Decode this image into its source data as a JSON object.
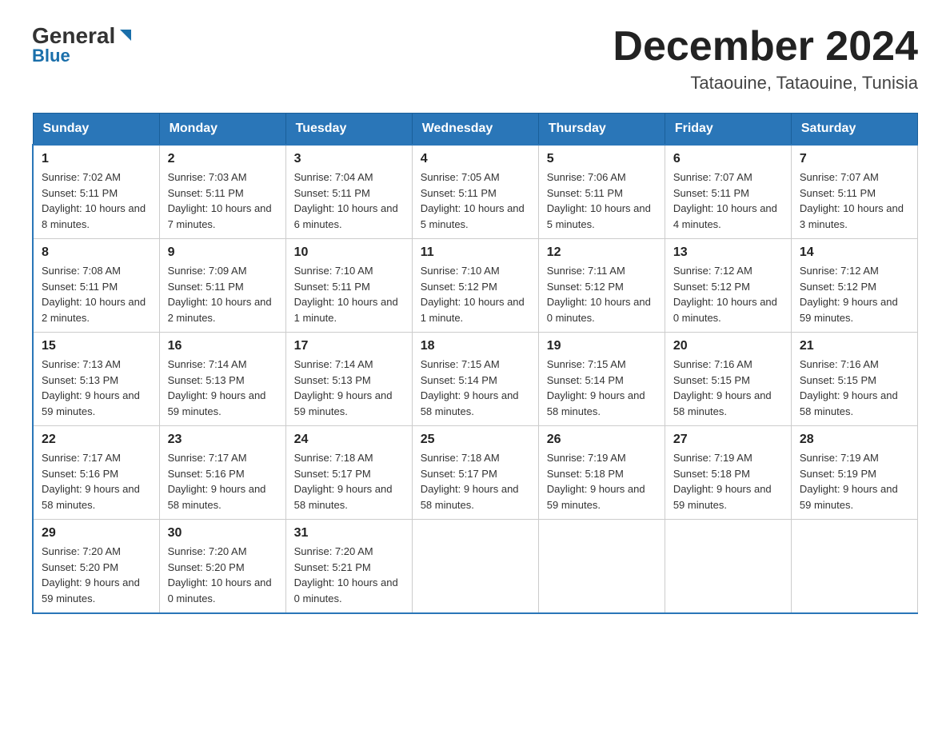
{
  "logo": {
    "general": "General",
    "blue": "Blue"
  },
  "title": "December 2024",
  "subtitle": "Tataouine, Tataouine, Tunisia",
  "days": [
    "Sunday",
    "Monday",
    "Tuesday",
    "Wednesday",
    "Thursday",
    "Friday",
    "Saturday"
  ],
  "weeks": [
    [
      {
        "day": "1",
        "sunrise": "7:02 AM",
        "sunset": "5:11 PM",
        "daylight": "10 hours and 8 minutes."
      },
      {
        "day": "2",
        "sunrise": "7:03 AM",
        "sunset": "5:11 PM",
        "daylight": "10 hours and 7 minutes."
      },
      {
        "day": "3",
        "sunrise": "7:04 AM",
        "sunset": "5:11 PM",
        "daylight": "10 hours and 6 minutes."
      },
      {
        "day": "4",
        "sunrise": "7:05 AM",
        "sunset": "5:11 PM",
        "daylight": "10 hours and 5 minutes."
      },
      {
        "day": "5",
        "sunrise": "7:06 AM",
        "sunset": "5:11 PM",
        "daylight": "10 hours and 5 minutes."
      },
      {
        "day": "6",
        "sunrise": "7:07 AM",
        "sunset": "5:11 PM",
        "daylight": "10 hours and 4 minutes."
      },
      {
        "day": "7",
        "sunrise": "7:07 AM",
        "sunset": "5:11 PM",
        "daylight": "10 hours and 3 minutes."
      }
    ],
    [
      {
        "day": "8",
        "sunrise": "7:08 AM",
        "sunset": "5:11 PM",
        "daylight": "10 hours and 2 minutes."
      },
      {
        "day": "9",
        "sunrise": "7:09 AM",
        "sunset": "5:11 PM",
        "daylight": "10 hours and 2 minutes."
      },
      {
        "day": "10",
        "sunrise": "7:10 AM",
        "sunset": "5:11 PM",
        "daylight": "10 hours and 1 minute."
      },
      {
        "day": "11",
        "sunrise": "7:10 AM",
        "sunset": "5:12 PM",
        "daylight": "10 hours and 1 minute."
      },
      {
        "day": "12",
        "sunrise": "7:11 AM",
        "sunset": "5:12 PM",
        "daylight": "10 hours and 0 minutes."
      },
      {
        "day": "13",
        "sunrise": "7:12 AM",
        "sunset": "5:12 PM",
        "daylight": "10 hours and 0 minutes."
      },
      {
        "day": "14",
        "sunrise": "7:12 AM",
        "sunset": "5:12 PM",
        "daylight": "9 hours and 59 minutes."
      }
    ],
    [
      {
        "day": "15",
        "sunrise": "7:13 AM",
        "sunset": "5:13 PM",
        "daylight": "9 hours and 59 minutes."
      },
      {
        "day": "16",
        "sunrise": "7:14 AM",
        "sunset": "5:13 PM",
        "daylight": "9 hours and 59 minutes."
      },
      {
        "day": "17",
        "sunrise": "7:14 AM",
        "sunset": "5:13 PM",
        "daylight": "9 hours and 59 minutes."
      },
      {
        "day": "18",
        "sunrise": "7:15 AM",
        "sunset": "5:14 PM",
        "daylight": "9 hours and 58 minutes."
      },
      {
        "day": "19",
        "sunrise": "7:15 AM",
        "sunset": "5:14 PM",
        "daylight": "9 hours and 58 minutes."
      },
      {
        "day": "20",
        "sunrise": "7:16 AM",
        "sunset": "5:15 PM",
        "daylight": "9 hours and 58 minutes."
      },
      {
        "day": "21",
        "sunrise": "7:16 AM",
        "sunset": "5:15 PM",
        "daylight": "9 hours and 58 minutes."
      }
    ],
    [
      {
        "day": "22",
        "sunrise": "7:17 AM",
        "sunset": "5:16 PM",
        "daylight": "9 hours and 58 minutes."
      },
      {
        "day": "23",
        "sunrise": "7:17 AM",
        "sunset": "5:16 PM",
        "daylight": "9 hours and 58 minutes."
      },
      {
        "day": "24",
        "sunrise": "7:18 AM",
        "sunset": "5:17 PM",
        "daylight": "9 hours and 58 minutes."
      },
      {
        "day": "25",
        "sunrise": "7:18 AM",
        "sunset": "5:17 PM",
        "daylight": "9 hours and 58 minutes."
      },
      {
        "day": "26",
        "sunrise": "7:19 AM",
        "sunset": "5:18 PM",
        "daylight": "9 hours and 59 minutes."
      },
      {
        "day": "27",
        "sunrise": "7:19 AM",
        "sunset": "5:18 PM",
        "daylight": "9 hours and 59 minutes."
      },
      {
        "day": "28",
        "sunrise": "7:19 AM",
        "sunset": "5:19 PM",
        "daylight": "9 hours and 59 minutes."
      }
    ],
    [
      {
        "day": "29",
        "sunrise": "7:20 AM",
        "sunset": "5:20 PM",
        "daylight": "9 hours and 59 minutes."
      },
      {
        "day": "30",
        "sunrise": "7:20 AM",
        "sunset": "5:20 PM",
        "daylight": "10 hours and 0 minutes."
      },
      {
        "day": "31",
        "sunrise": "7:20 AM",
        "sunset": "5:21 PM",
        "daylight": "10 hours and 0 minutes."
      },
      null,
      null,
      null,
      null
    ]
  ],
  "sunrise_label": "Sunrise:",
  "sunset_label": "Sunset:",
  "daylight_label": "Daylight:"
}
